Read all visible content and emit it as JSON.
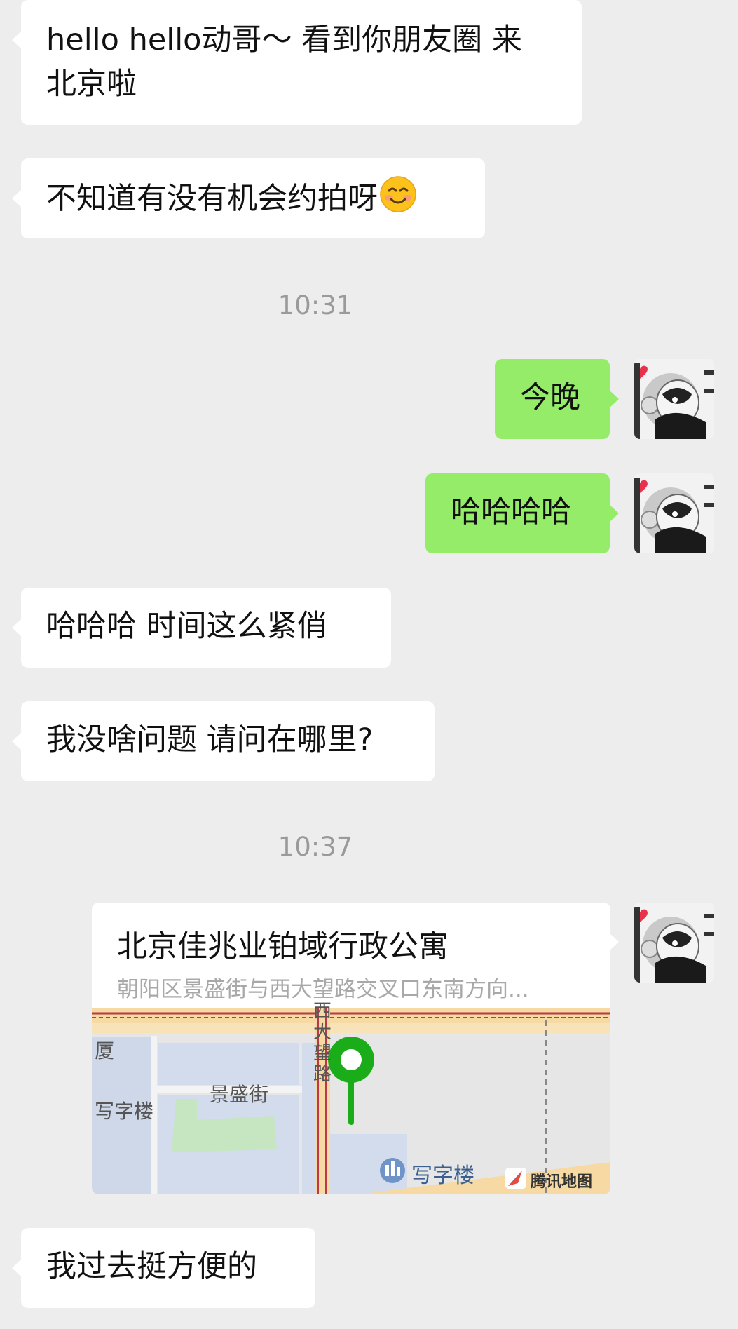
{
  "messages": [
    {
      "side": "in",
      "text_line1": "hello hello动哥～ 看到你朋友圈 来",
      "text_line2": "北京啦"
    },
    {
      "side": "in",
      "text": "不知道有没有机会约拍呀",
      "emoji": "smiling-face-icon"
    },
    {
      "side": "time",
      "text": "10:31"
    },
    {
      "side": "out",
      "text": "今晚"
    },
    {
      "side": "out",
      "text": "哈哈哈哈"
    },
    {
      "side": "in",
      "text": "哈哈哈 时间这么紧俏"
    },
    {
      "side": "in",
      "text": "我没啥问题 请问在哪里?"
    },
    {
      "side": "time",
      "text": "10:37"
    },
    {
      "side": "out",
      "type": "location"
    },
    {
      "side": "in",
      "text": "我过去挺方便的"
    }
  ],
  "location": {
    "title": "北京佳兆业铂域行政公寓",
    "address": "朝阳区景盛街与西大望路交叉口东南方向...",
    "map_labels": {
      "road_vertical_1": "西",
      "road_vertical_2": "大",
      "road_vertical_3": "望",
      "road_vertical_4": "路",
      "street": "景盛街",
      "left_top": "厦",
      "left_office": "写字楼",
      "poi_office": "写字楼",
      "brand": "腾讯地图"
    }
  },
  "colors": {
    "background": "#ededed",
    "incoming_bubble": "#ffffff",
    "outgoing_bubble": "#95ec69",
    "timestamp": "#9a9a9a",
    "pin": "#1aad19"
  }
}
